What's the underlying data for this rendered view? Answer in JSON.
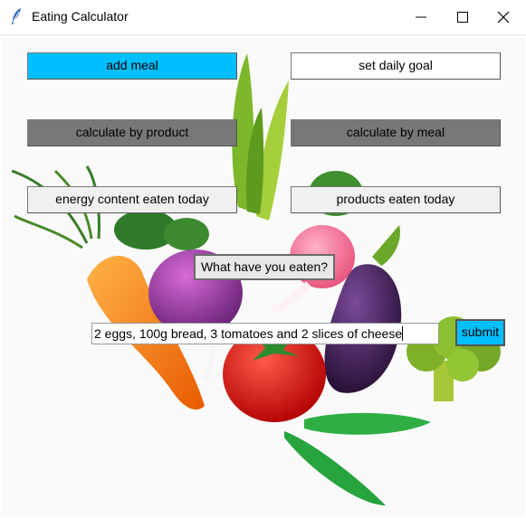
{
  "window": {
    "title": "Eating Calculator"
  },
  "buttons": {
    "add_meal": "add meal",
    "set_daily_goal": "set daily goal",
    "calc_product": "calculate by product",
    "calc_meal": "calculate by meal",
    "energy_today": "energy content eaten today",
    "products_today": "products eaten today",
    "submit": "submit"
  },
  "prompt": {
    "label": "What have you eaten?"
  },
  "input": {
    "value": "2 eggs, 100g bread, 3 tomatoes and 2 slices of cheese"
  },
  "colors": {
    "accent": "#00bfff",
    "button_gray": "#787878",
    "button_light": "#f0f0f0"
  },
  "icons": [
    "feather-icon",
    "minimize-icon",
    "maximize-icon",
    "close-icon"
  ]
}
